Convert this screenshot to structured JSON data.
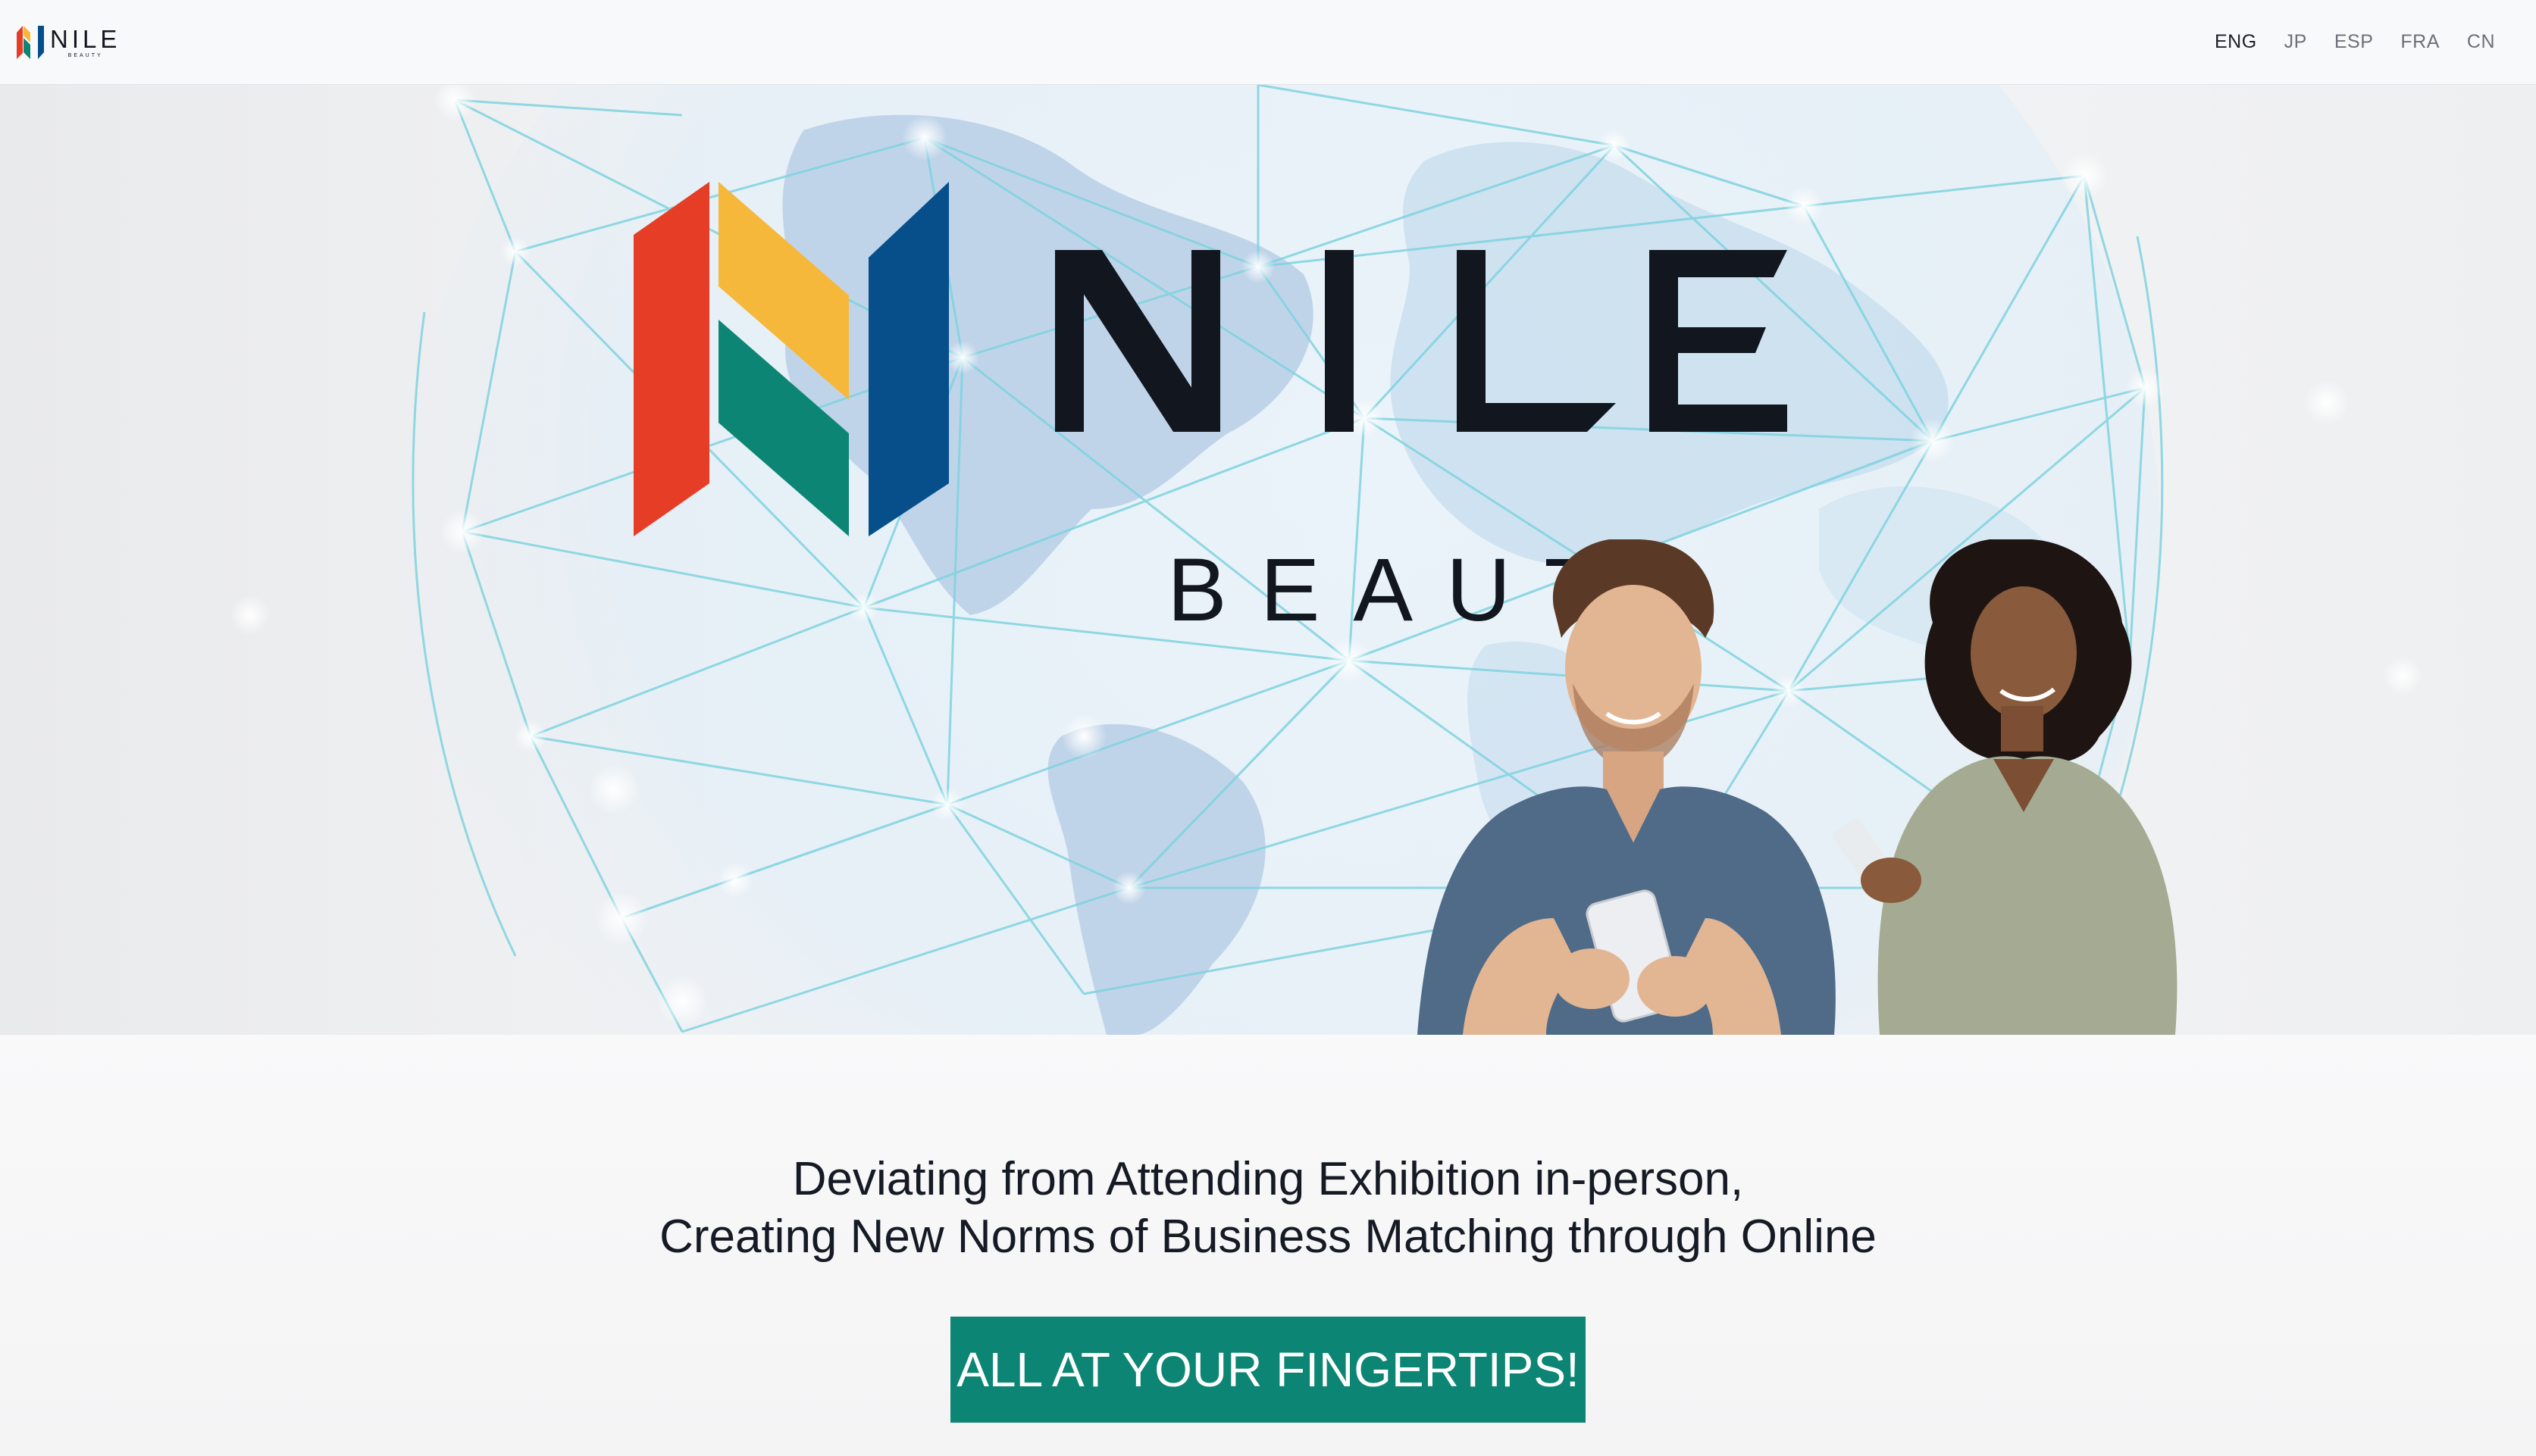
{
  "header": {
    "logo_word": "NILE",
    "logo_sub": "BEAUTY",
    "languages": [
      {
        "label": "ENG",
        "active": true
      },
      {
        "label": "JP",
        "active": false
      },
      {
        "label": "ESP",
        "active": false
      },
      {
        "label": "FRA",
        "active": false
      },
      {
        "label": "CN",
        "active": false
      }
    ]
  },
  "hero": {
    "brand_word": "NILE",
    "brand_sub": "BEAUTY"
  },
  "tagline": {
    "line1": "Deviating from Attending Exhibition in-person,",
    "line2": "Creating New Norms of Business Matching through Online"
  },
  "cta": {
    "label": "ALL AT YOUR FINGERTIPS!"
  },
  "colors": {
    "brand_red": "#e63e26",
    "brand_yellow": "#f6b83a",
    "brand_green": "#0d8574",
    "brand_blue": "#064f8a",
    "text_dark": "#11161f",
    "cta_bg": "#0d8574"
  },
  "icons": {
    "logo": "nile-beauty-n-logo-icon"
  }
}
